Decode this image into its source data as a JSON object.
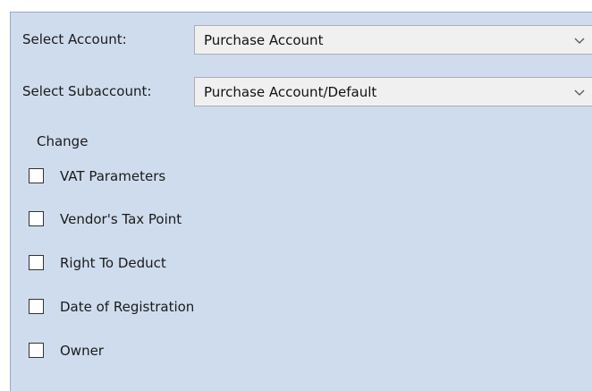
{
  "account": {
    "label": "Select Account:",
    "value": "Purchase Account"
  },
  "subaccount": {
    "label": "Select Subaccount:",
    "value": "Purchase Account/Default"
  },
  "change": {
    "title": "Change",
    "options": [
      {
        "label": "VAT Parameters",
        "checked": false
      },
      {
        "label": "Vendor's Tax Point",
        "checked": false
      },
      {
        "label": "Right To Deduct",
        "checked": false
      },
      {
        "label": "Date of Registration",
        "checked": false
      },
      {
        "label": "Owner",
        "checked": false
      }
    ]
  },
  "icons": {
    "dropdown": "chevron-down-icon"
  },
  "colors": {
    "panel_background": "#cfdcee",
    "combo_background": "#f0f0f0"
  }
}
